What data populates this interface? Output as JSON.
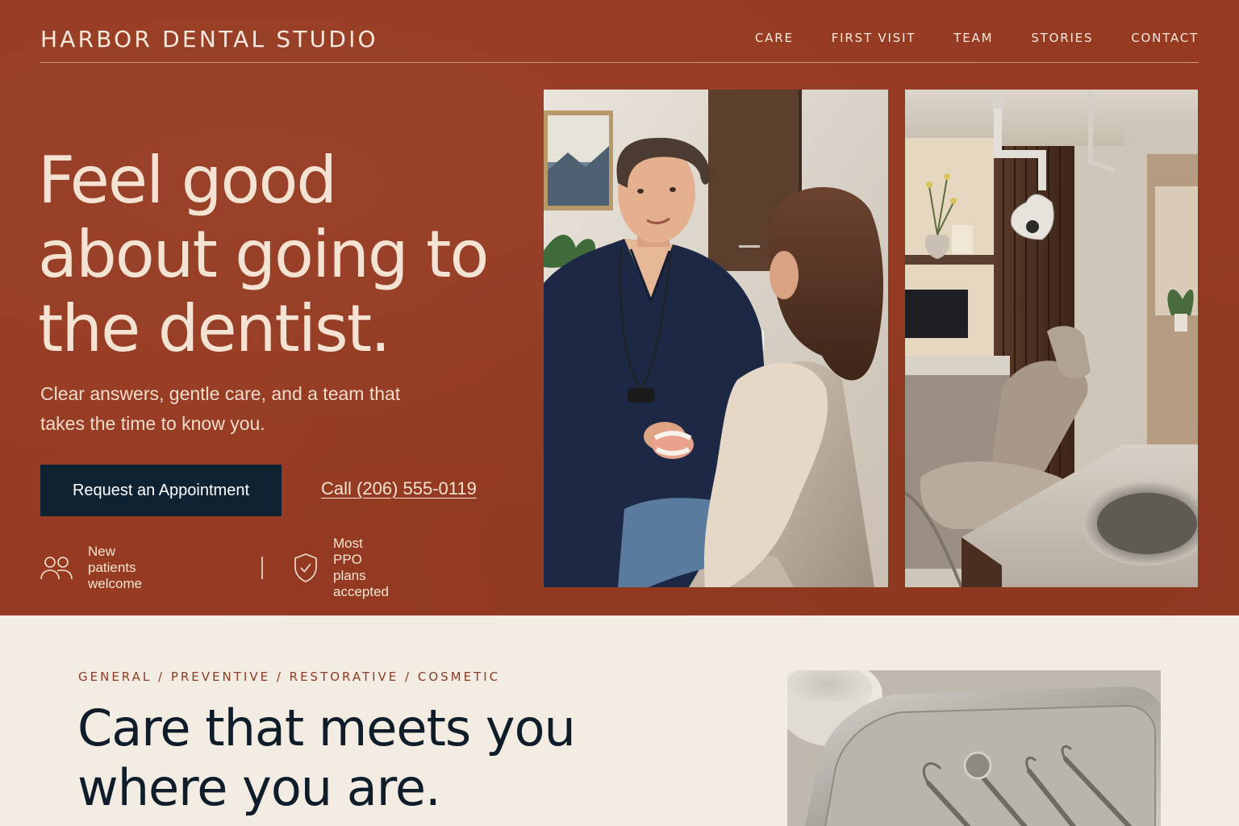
{
  "header": {
    "brand": "HARBOR DENTAL STUDIO",
    "nav": [
      "CARE",
      "FIRST VISIT",
      "TEAM",
      "STORIES",
      "CONTACT"
    ]
  },
  "hero": {
    "headline": "Feel good about going to the dentist.",
    "subhead": "Clear answers, gentle care, and a team that takes the time to know you.",
    "primary_cta": "Request an Appointment",
    "phone_link": "Call (206) 555-0119",
    "badges": [
      {
        "icon": "people-icon",
        "label": "New patients welcome"
      },
      {
        "icon": "shield-check-icon",
        "label": "Most PPO plans accepted"
      }
    ],
    "images": [
      "dentist-with-patient-photo",
      "treatment-room-photo"
    ]
  },
  "services": {
    "eyebrow": "GENERAL / PREVENTIVE / RESTORATIVE / COSMETIC",
    "title": "Care that meets you where you are.",
    "image": "dental-instruments-tray-photo"
  },
  "colors": {
    "hero_background": "#963b22",
    "cream_text": "#f4e3d2",
    "navy_button": "#0e2232",
    "page_background": "#f3ece3",
    "accent_rust": "#8d3b22"
  }
}
